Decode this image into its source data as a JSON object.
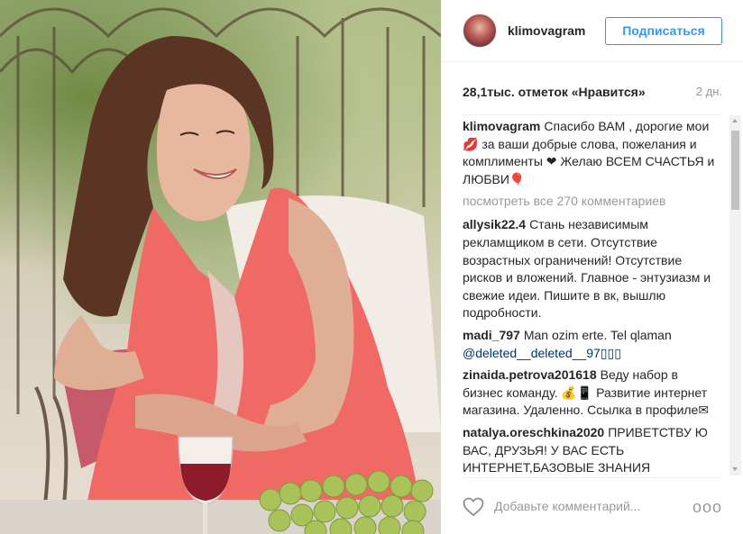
{
  "post": {
    "username": "klimovagram",
    "follow_label": "Подписаться",
    "likes": "28,1тыс. отметок «Нравится»",
    "age": "2 дн.",
    "caption_user": "klimovagram",
    "caption_text": "Спасибо ВАМ , дорогие мои 💋 за ваши добрые слова, пожелания и комплименты ❤ Желаю ВСЕМ СЧАСТЬЯ и ЛЮБВИ🎈",
    "view_all": "посмотреть все 270 комментариев"
  },
  "comments": [
    {
      "user": "allysik22.4",
      "text": "Стань независимым рекламщиком в сети. Отсутствие возрастных ограничений! Отсутствие рисков и вложений. Главное - энтузиазм и свежие идеи. Пишите в вк, вышлю подробности."
    },
    {
      "user": "madi_797",
      "text": "Man ozim erte. Tel qlaman",
      "mention": "@deleted__deleted__97▯▯▯"
    },
    {
      "user": "zinaida.petrova201618",
      "text": "Веду набор в бизнес команду. 💰📱 Развитие интернет магазина. Удаленно. Ссылка в профиле✉"
    },
    {
      "user": "natalya.oreschkina2020",
      "text": "ПРИВЕТСТВУ Ю ВАС, ДРУЗЬЯ! У ВАС ЕСТЬ ИНТЕРНЕТ,БАЗОВЫЕ ЗНАНИЯ"
    }
  ],
  "footer": {
    "comment_placeholder": "Добавьте комментарий...",
    "more_label": "ооо"
  },
  "icons": {
    "like": "heart-outline-icon",
    "more": "more-options-icon"
  },
  "colors": {
    "link_blue": "#3897f0",
    "muted": "#999999",
    "text": "#262626"
  }
}
